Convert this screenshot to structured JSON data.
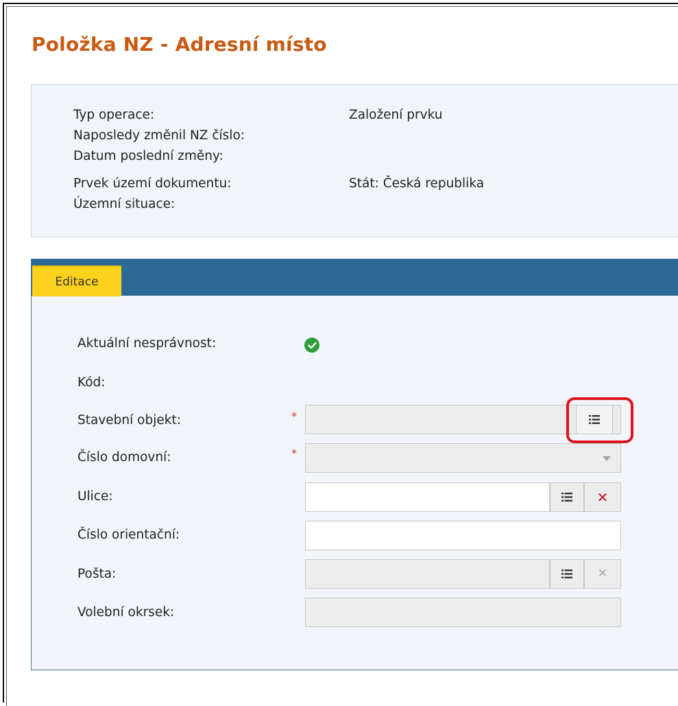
{
  "page": {
    "title": "Položka NZ - Adresní místo"
  },
  "info": {
    "rows": [
      {
        "label": "Typ operace:",
        "value": "Založení prvku"
      },
      {
        "label": "Naposledy změnil NZ číslo:",
        "value": ""
      },
      {
        "label": "Datum poslední změny:",
        "value": ""
      },
      {
        "label": "Prvek území dokumentu:",
        "value": "Stát: Česká republika"
      },
      {
        "label": "Územní situace:",
        "value": ""
      }
    ]
  },
  "edit": {
    "tab_label": "Editace",
    "fields": {
      "aktualni": {
        "label": "Aktuální nesprávnost:",
        "status_icon": "check-circle-icon"
      },
      "kod": {
        "label": "Kód:"
      },
      "stavebni_objekt": {
        "label": "Stavební objekt:",
        "required_mark": "*",
        "value": ""
      },
      "cislo_domovni": {
        "label": "Číslo domovní:",
        "required_mark": "*",
        "value": ""
      },
      "ulice": {
        "label": "Ulice:",
        "value": ""
      },
      "cislo_orientacni": {
        "label": "Číslo orientační:",
        "value": ""
      },
      "posta": {
        "label": "Pošta:",
        "value": ""
      },
      "volebni_okrsek": {
        "label": "Volební okrsek:",
        "value": ""
      }
    }
  },
  "icons": {
    "list": "list-icon",
    "clear": "close-icon",
    "dropdown": "chevron-down-icon",
    "check": "check-circle-icon"
  },
  "colors": {
    "title": "#c95a12",
    "tab_bar": "#2d6a93",
    "tab_active": "#fbd11c",
    "check": "#2e9d3c",
    "clear_active": "#c0141e",
    "clear_disabled": "#a6a6a6",
    "highlight": "#e0141e"
  }
}
